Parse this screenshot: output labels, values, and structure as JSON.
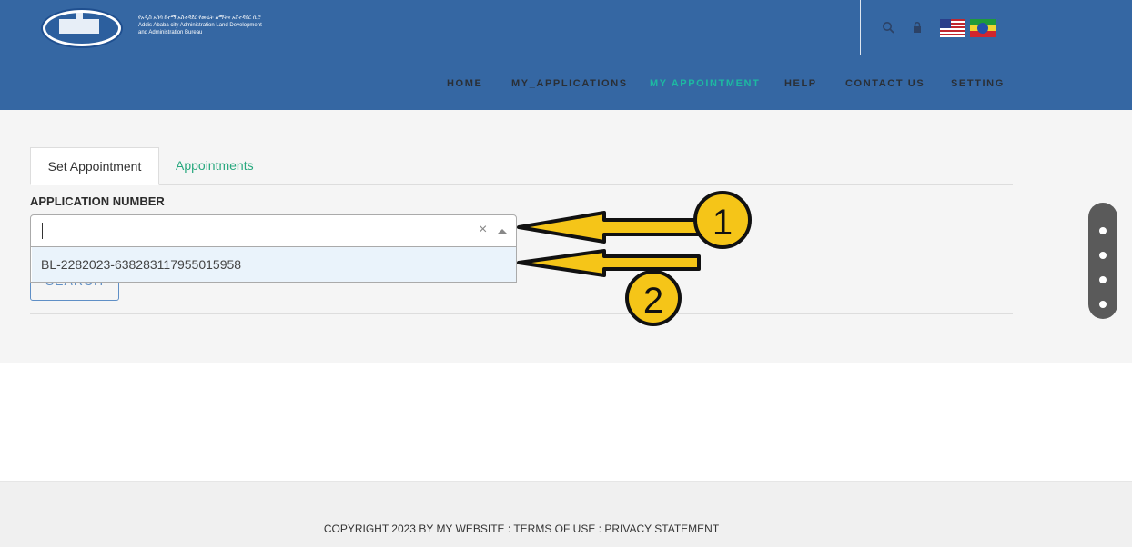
{
  "header": {
    "logo_lines": [
      "የአዲስ አበባ ከተማ አስተዳደር የመሬት ልማትና አስተዳደር ቢሮ",
      "Addis Ababa city Administration Land Development",
      "and Administration Bureau"
    ],
    "icons": [
      "search-icon",
      "lock-icon"
    ],
    "flags": [
      "us-flag",
      "ethiopia-flag"
    ]
  },
  "nav": {
    "items": [
      {
        "label": "HOME"
      },
      {
        "label": "MY_APPLICATIONS"
      },
      {
        "label": "MY APPOINTMENT",
        "active": true
      },
      {
        "label": "HELP"
      },
      {
        "label": "CONTACT US"
      },
      {
        "label": "SETTING"
      }
    ]
  },
  "tabs": [
    {
      "label": "Set Appointment",
      "active": true
    },
    {
      "label": "Appointments"
    }
  ],
  "form": {
    "label": "APPLICATION NUMBER",
    "input_value": "",
    "clear_symbol": "×",
    "options": [
      "BL-2282023-638283117955015958"
    ],
    "search_label": "SEARCH"
  },
  "annotations": [
    "1",
    "2"
  ],
  "footer": {
    "text": "COPYRIGHT 2023 BY MY WEBSITE : TERMS OF USE : PRIVACY STATEMENT"
  },
  "colors": {
    "header_bg": "#3567a3",
    "nav_active": "#1db9a2",
    "tab_link": "#28a87e",
    "annotation_fill": "#f5c518"
  }
}
